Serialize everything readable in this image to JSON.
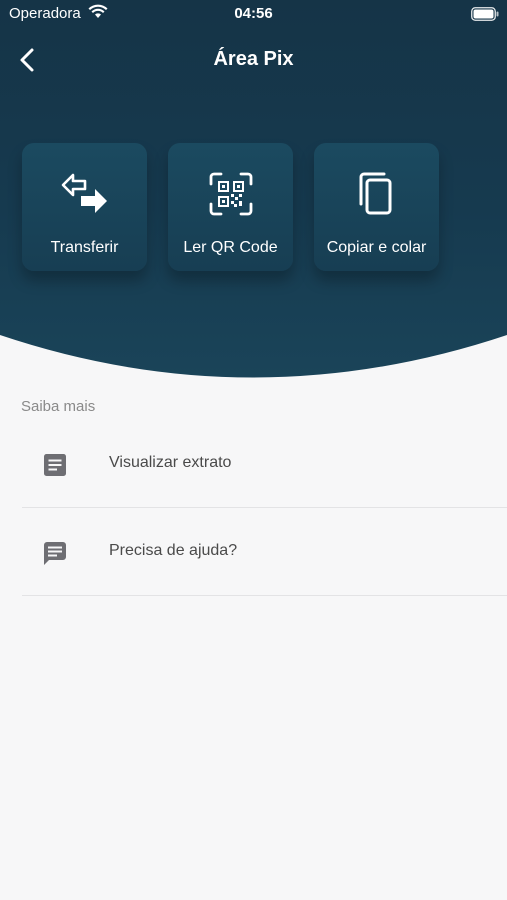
{
  "status_bar": {
    "carrier": "Operadora",
    "time": "04:56"
  },
  "nav": {
    "title": "Área Pix"
  },
  "actions": [
    {
      "label": "Transferir",
      "icon": "transfer-icon"
    },
    {
      "label": "Ler QR Code",
      "icon": "qr-code-icon"
    },
    {
      "label": "Copiar e colar",
      "icon": "copy-icon"
    }
  ],
  "learn_more": {
    "title": "Saiba mais",
    "items": [
      {
        "label": "Visualizar extrato",
        "icon": "document-icon"
      },
      {
        "label": "Precisa de ajuda?",
        "icon": "chat-icon"
      }
    ]
  },
  "colors": {
    "header": "#163a4f",
    "background": "#f7f7f8"
  }
}
